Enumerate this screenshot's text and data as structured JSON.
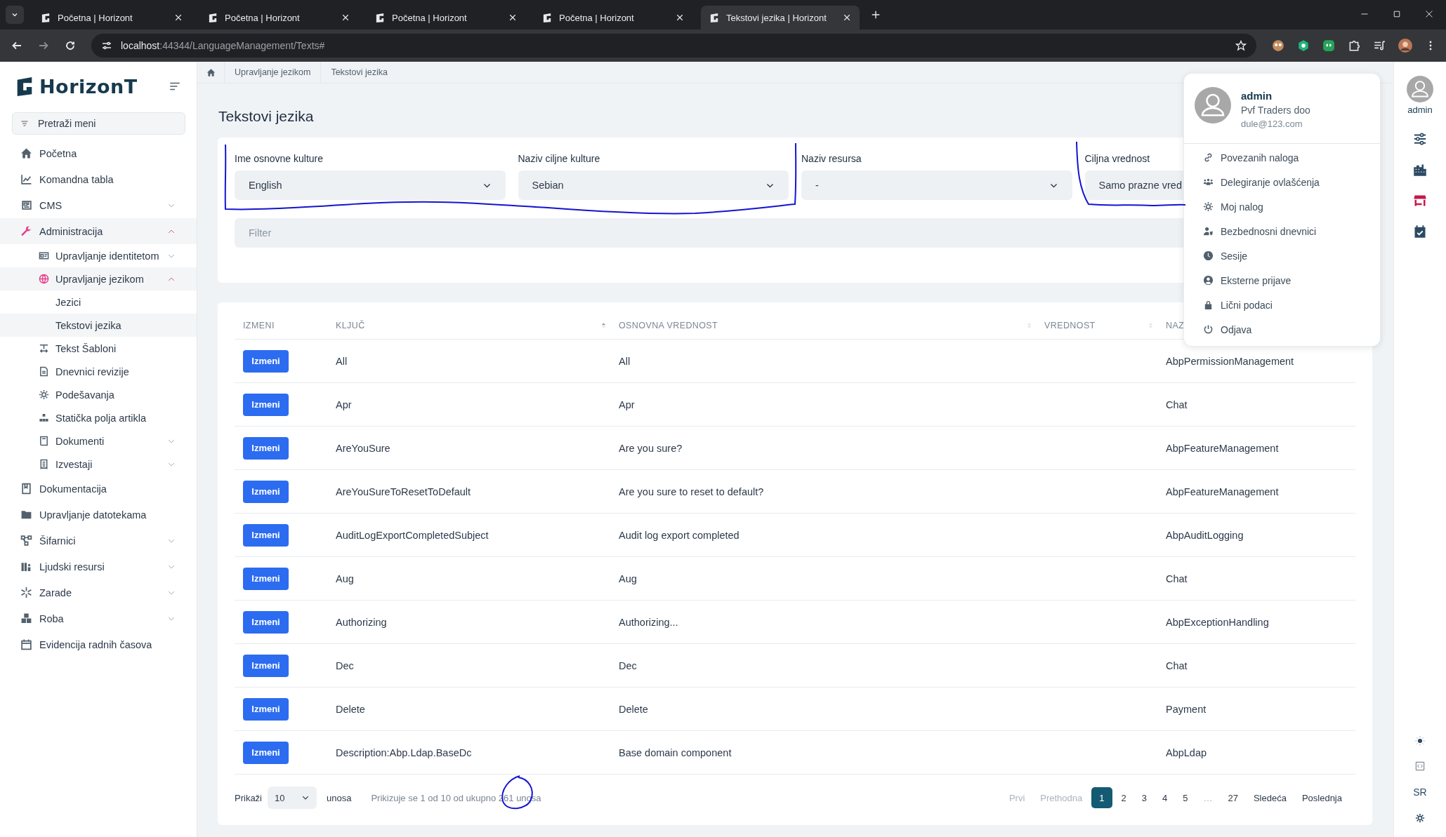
{
  "browser": {
    "tabs": [
      {
        "title": "Početna | Horizont",
        "selected": false
      },
      {
        "title": "Početna | Horizont",
        "selected": false
      },
      {
        "title": "Početna | Horizont",
        "selected": false
      },
      {
        "title": "Početna | Horizont",
        "selected": false
      },
      {
        "title": "Tekstovi jezika | Horizont",
        "selected": true
      }
    ],
    "url": "**localhost**:44344/LanguageManagement/Texts#"
  },
  "app": {
    "logo": "HorizonT",
    "menu_search": {
      "placeholder": "Pretraži meni"
    }
  },
  "sidebar": {
    "items": [
      {
        "label": "Početna",
        "selected": false
      },
      {
        "label": "Komandna tabla",
        "selected": false
      },
      {
        "label": "CMS",
        "selected": false,
        "expanded": false
      },
      {
        "label": "Administracija",
        "selected": true,
        "expanded": true,
        "children": [
          {
            "label": "Upravljanje identitetom",
            "selected": false,
            "expanded": false
          },
          {
            "label": "Upravljanje jezikom",
            "selected": true,
            "expanded": true,
            "children": [
              {
                "label": "Jezici",
                "selected": false
              },
              {
                "label": "Tekstovi jezika",
                "selected": true
              }
            ]
          },
          {
            "label": "Tekst Šabloni",
            "selected": false
          },
          {
            "label": "Dnevnici revizije",
            "selected": false
          },
          {
            "label": "Podešavanja",
            "selected": false
          },
          {
            "label": "Statička polja artikla",
            "selected": false
          },
          {
            "label": "Dokumenti",
            "selected": false,
            "expanded": false
          },
          {
            "label": "Izvestaji",
            "selected": false,
            "expanded": false
          }
        ]
      },
      {
        "label": "Dokumentacija",
        "selected": false
      },
      {
        "label": "Upravljanje datotekama",
        "selected": false
      },
      {
        "label": "Šifarnici",
        "selected": false,
        "expanded": false
      },
      {
        "label": "Ljudski resursi",
        "selected": false,
        "expanded": false
      },
      {
        "label": "Zarade",
        "selected": false,
        "expanded": false
      },
      {
        "label": "Roba",
        "selected": false,
        "expanded": false
      },
      {
        "label": "Evidencija radnih časova",
        "selected": false
      }
    ]
  },
  "breadcrumb": [
    "Upravljanje jezikom",
    "Tekstovi jezika"
  ],
  "page_title": "Tekstovi jezika",
  "filters": [
    {
      "label": "Ime osnovne kulture",
      "value": "English"
    },
    {
      "label": "Naziv ciljne kulture",
      "value": "Sebian"
    },
    {
      "label": "Naziv resursa",
      "value": "-"
    },
    {
      "label": "Ciljna vrednost",
      "value": "Samo prazne vred"
    }
  ],
  "filter_input": {
    "placeholder": "Filter"
  },
  "table": {
    "columns": [
      {
        "label": "IZMENI"
      },
      {
        "label": "KLJUČ",
        "sorted": true
      },
      {
        "label": "OSNOVNA VREDNOST",
        "sorted": false
      },
      {
        "label": "VREDNOST",
        "sorted": false
      },
      {
        "label": "NAZ"
      }
    ],
    "rows": [
      {
        "button": "Izmeni",
        "key": "All",
        "base_value": "All",
        "resource": "AbpPermissionManagement"
      },
      {
        "button": "Izmeni",
        "key": "Apr",
        "base_value": "Apr",
        "resource": "Chat"
      },
      {
        "button": "Izmeni",
        "key": "AreYouSure",
        "base_value": "Are you sure?",
        "resource": "AbpFeatureManagement"
      },
      {
        "button": "Izmeni",
        "key": "AreYouSureToResetToDefault",
        "base_value": "Are you sure to reset to default?",
        "resource": "AbpFeatureManagement"
      },
      {
        "button": "Izmeni",
        "key": "AuditLogExportCompletedSubject",
        "base_value": "Audit log export completed",
        "resource": "AbpAuditLogging"
      },
      {
        "button": "Izmeni",
        "key": "Aug",
        "base_value": "Aug",
        "resource": "Chat"
      },
      {
        "button": "Izmeni",
        "key": "Authorizing",
        "base_value": "Authorizing...",
        "resource": "AbpExceptionHandling"
      },
      {
        "button": "Izmeni",
        "key": "Dec",
        "base_value": "Dec",
        "resource": "Chat"
      },
      {
        "button": "Izmeni",
        "key": "Delete",
        "base_value": "Delete",
        "resource": "Payment"
      },
      {
        "button": "Izmeni",
        "key": "Description:Abp.Ldap.BaseDc",
        "base_value": "Base domain component",
        "resource": "AbpLdap"
      }
    ]
  },
  "footer": {
    "show_label": "Prikaži",
    "page_size": "10",
    "entries_label": "unosa",
    "info": "Prikizuje se 1 od 10 od ukupno 261 unosa",
    "pages": [
      {
        "label": "Prvi",
        "selected": false,
        "disabled": true
      },
      {
        "label": "Prethodna",
        "selected": false,
        "disabled": true
      },
      {
        "label": "1",
        "selected": true,
        "disabled": false
      },
      {
        "label": "2",
        "selected": false,
        "disabled": false
      },
      {
        "label": "3",
        "selected": false,
        "disabled": false
      },
      {
        "label": "4",
        "selected": false,
        "disabled": false
      },
      {
        "label": "5",
        "selected": false,
        "disabled": false
      },
      {
        "label": "…",
        "selected": false,
        "disabled": true
      },
      {
        "label": "27",
        "selected": false,
        "disabled": false
      },
      {
        "label": "Sledeća",
        "selected": false,
        "disabled": false
      },
      {
        "label": "Poslednja",
        "selected": false,
        "disabled": false
      }
    ]
  },
  "user_menu": {
    "name": "admin",
    "company": "Pvf Traders doo",
    "email": "dule@123.com",
    "items": [
      "Povezanih naloga",
      "Delegiranje ovlašćenja",
      "Moj nalog",
      "Bezbednosni dnevnici",
      "Sesije",
      "Eksterne prijave",
      "Lični podaci",
      "Odjava"
    ]
  },
  "right_rail": {
    "user": "admin",
    "language": "SR"
  }
}
